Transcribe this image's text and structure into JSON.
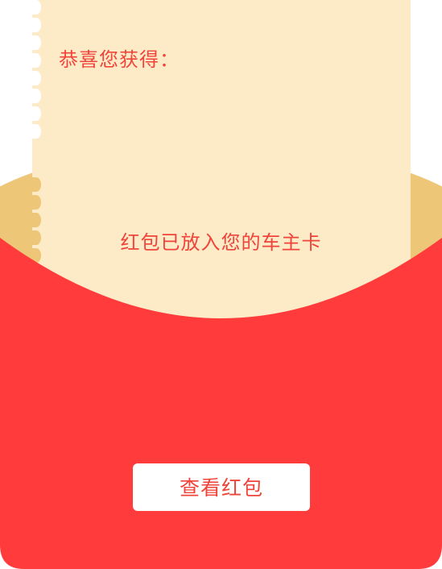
{
  "card": {
    "congrats_label": "恭喜您获得：",
    "deposit_message": "红包已放入您的车主卡"
  },
  "actions": {
    "view_button_label": "查看红包"
  },
  "colors": {
    "envelope_red": "#ff3b3b",
    "lining_gold": "#eec677",
    "card_cream": "#fdebc8",
    "text_red": "#f0443b",
    "button_bg": "#ffffff"
  }
}
